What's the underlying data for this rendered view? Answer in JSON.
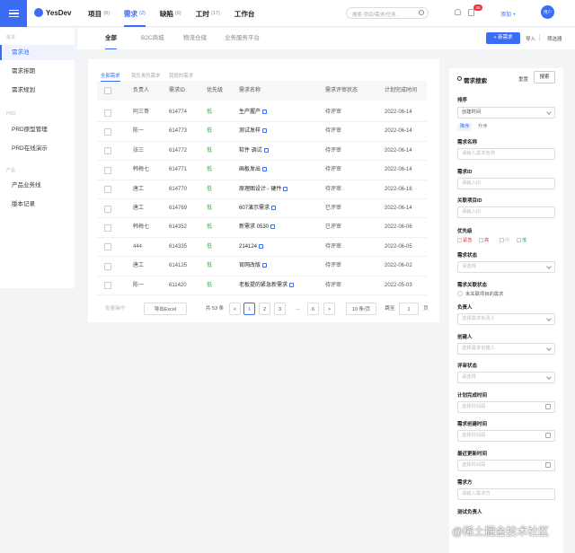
{
  "app": {
    "logo": "YesDev"
  },
  "nav": [
    {
      "label": "项目",
      "count": "(8)"
    },
    {
      "label": "需求",
      "count": "(2)"
    },
    {
      "label": "缺陷",
      "count": "(6)"
    },
    {
      "label": "工时",
      "count": "(17)"
    },
    {
      "label": "工作台",
      "count": ""
    }
  ],
  "header": {
    "search_placeholder": "搜索 项目/需求/任务...",
    "badge": "25",
    "add_new": "添加 +",
    "avatar": "用户"
  },
  "sidebar": {
    "sections": [
      {
        "caption": "需求",
        "items": [
          "需求池",
          "需求排期",
          "需求规划"
        ]
      },
      {
        "caption": "PRD",
        "items": [
          "PRD原型管理",
          "PRD在线演示"
        ]
      },
      {
        "caption": "产品",
        "items": [
          "产品业务线",
          "版本记录"
        ]
      }
    ]
  },
  "tabs": [
    "全部",
    "B2C商城",
    "物流仓储",
    "业务服务平台"
  ],
  "toolbar": {
    "new": "+ 新需求",
    "import": "导入",
    "filter": "筛选器"
  },
  "subtabs": [
    "全部需求",
    "我负责的需求",
    "我提的需求"
  ],
  "table": {
    "headers": [
      "负责人",
      "需求ID",
      "优先级",
      "需求名称",
      "需求评审状态",
      "计划完成时间"
    ],
    "rows": [
      [
        "阿三哥",
        "614774",
        "低",
        "生产握产",
        "待评审",
        "2022-06-14"
      ],
      [
        "陈一",
        "614773",
        "低",
        "测试发样",
        "待评审",
        "2022-06-14"
      ],
      [
        "张三",
        "614772",
        "低",
        "软件 调试",
        "待评审",
        "2022-06-14"
      ],
      [
        "韩梅七",
        "614771",
        "低",
        "画板发出",
        "待评审",
        "2022-06-14"
      ],
      [
        "唐工",
        "614770",
        "低",
        "原理图设计 - 硬件",
        "待评审",
        "2022-06-16"
      ],
      [
        "唐工",
        "614769",
        "低",
        "607演示需求",
        "已评审",
        "2022-06-14"
      ],
      [
        "韩梅七",
        "614352",
        "低",
        "新需求 0530",
        "已评审",
        "2022-06-06"
      ],
      [
        "444",
        "614335",
        "低",
        "214124",
        "待评审",
        "2022-06-05"
      ],
      [
        "唐工",
        "614125",
        "低",
        "官网改版",
        "待评审",
        "2022-06-02"
      ],
      [
        "陈一",
        "611420",
        "低",
        "老板提的紧急新需求",
        "待评审",
        "2022-05-03"
      ]
    ]
  },
  "pager": {
    "batch": "批量操作",
    "export": "导出Excel",
    "total": "共 53 条",
    "prev": "<",
    "pages": [
      "1",
      "2",
      "3",
      "...",
      "6"
    ],
    "next": ">",
    "size": "10 条/页",
    "jump": "跳至",
    "jump_value": "1",
    "page_unit": "页"
  },
  "filter": {
    "title": "需求搜索",
    "reset": "重置",
    "search": "搜索",
    "sort_label": "排序",
    "sort_value": "创建时间",
    "desc": "降序",
    "asc": "升序",
    "fields": [
      {
        "label": "需求名称",
        "placeholder": "请输入需求名称",
        "kind": "text"
      },
      {
        "label": "需求ID",
        "placeholder": "请输入ID",
        "kind": "text"
      },
      {
        "label": "关联项目ID",
        "placeholder": "请输入ID",
        "kind": "text"
      }
    ],
    "priority_label": "优先级",
    "priority_opts": [
      "紧急",
      "高",
      "中",
      "低"
    ],
    "status_label": "需求状态",
    "status_placeholder": "请选择",
    "related_label": "需求关联状态",
    "related_opt": "未关联项目的需求",
    "fields2": [
      {
        "label": "负责人",
        "placeholder": "选择需求负责人",
        "kind": "select"
      },
      {
        "label": "创建人",
        "placeholder": "选择需求创建人",
        "kind": "select"
      },
      {
        "label": "评审状态",
        "placeholder": "请选择",
        "kind": "select"
      },
      {
        "label": "计划完成时间",
        "placeholder": "选择时间段",
        "kind": "date"
      },
      {
        "label": "需求创建时间",
        "placeholder": "选择时间段",
        "kind": "date"
      },
      {
        "label": "最近更新时间",
        "placeholder": "选择时间段",
        "kind": "date"
      },
      {
        "label": "需求方",
        "placeholder": "请输入需求方",
        "kind": "text"
      }
    ],
    "last_label": "测试负责人"
  },
  "watermark": "@稀土掘金技术社区",
  "colors": {
    "accent": "#3a6cf4",
    "priority_low": "#2aa84a",
    "badge": "#e34"
  }
}
